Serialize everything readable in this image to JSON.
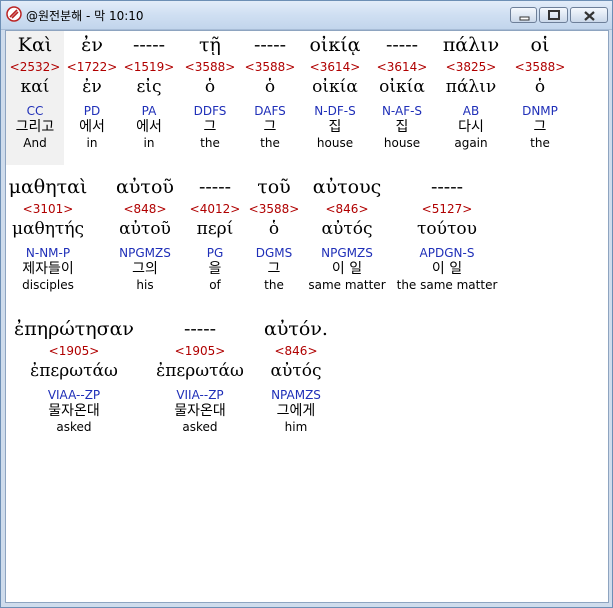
{
  "window": {
    "title": "@원전분해 - 막 10:10",
    "app_icon": "bible-app-icon",
    "controls": {
      "minimize": "minimize-icon",
      "maximize": "maximize-icon",
      "close": "close-icon"
    }
  },
  "lines": [
    [
      {
        "greek": "Καὶ",
        "strong": "<2532>",
        "lemma": "καί",
        "parse": "CC",
        "korean": "그리고",
        "english": "And"
      },
      {
        "greek": "ἐν",
        "strong": "<1722>",
        "lemma": "ἐν",
        "parse": "PD",
        "korean": "에서",
        "english": "in"
      },
      {
        "greek": "-----",
        "strong": "<1519>",
        "lemma": "εἰς",
        "parse": "PA",
        "korean": "에서",
        "english": "in"
      },
      {
        "greek": "τῇ",
        "strong": "<3588>",
        "lemma": "ὁ",
        "parse": "DDFS",
        "korean": "그",
        "english": "the"
      },
      {
        "greek": "-----",
        "strong": "<3588>",
        "lemma": "ὁ",
        "parse": "DAFS",
        "korean": "그",
        "english": "the"
      },
      {
        "greek": "οἰκίᾳ",
        "strong": "<3614>",
        "lemma": "οἰκία",
        "parse": "N-DF-S",
        "korean": "집",
        "english": "house"
      },
      {
        "greek": "-----",
        "strong": "<3614>",
        "lemma": "οἰκία",
        "parse": "N-AF-S",
        "korean": "집",
        "english": "house"
      },
      {
        "greek": "πάλιν",
        "strong": "<3825>",
        "lemma": "πάλιν",
        "parse": "AB",
        "korean": "다시",
        "english": "again"
      },
      {
        "greek": "οἱ",
        "strong": "<3588>",
        "lemma": "ὁ",
        "parse": "DNMP",
        "korean": "그",
        "english": "the"
      }
    ],
    [
      {
        "greek": "μαθηταὶ",
        "strong": "<3101>",
        "lemma": "μαθητής",
        "parse": "N-NM-P",
        "korean": "제자들이",
        "english": "disciples"
      },
      {
        "greek": "αὐτοῦ",
        "strong": "<848>",
        "lemma": "αὐτοῦ",
        "parse": "NPGMZS",
        "korean": "그의",
        "english": "his"
      },
      {
        "greek": "-----",
        "strong": "<4012>",
        "lemma": "περί",
        "parse": "PG",
        "korean": "을",
        "english": "of"
      },
      {
        "greek": "τοῦ",
        "strong": "<3588>",
        "lemma": "ὁ",
        "parse": "DGMS",
        "korean": "그",
        "english": "the"
      },
      {
        "greek": "αὐτους",
        "strong": "<846>",
        "lemma": "αὐτός",
        "parse": "NPGMZS",
        "korean": "이 일",
        "english": "same matter"
      },
      {
        "greek": "-----",
        "strong": "<5127>",
        "lemma": "τούτου",
        "parse": "APDGN-S",
        "korean": "이 일",
        "english": "the same matter"
      }
    ],
    [
      {
        "greek": "ἐπηρώτησαν",
        "strong": "<1905>",
        "lemma": "ἐπερωτάω",
        "parse": "VIAA--ZP",
        "korean": "물자온대",
        "english": "asked"
      },
      {
        "greek": "-----",
        "strong": "<1905>",
        "lemma": "ἐπερωτάω",
        "parse": "VIIA--ZP",
        "korean": "물자온대",
        "english": "asked"
      },
      {
        "greek": "αὐτόν.",
        "strong": "<846>",
        "lemma": "αὐτός",
        "parse": "NPAMZS",
        "korean": "그에게",
        "english": "him"
      }
    ]
  ]
}
